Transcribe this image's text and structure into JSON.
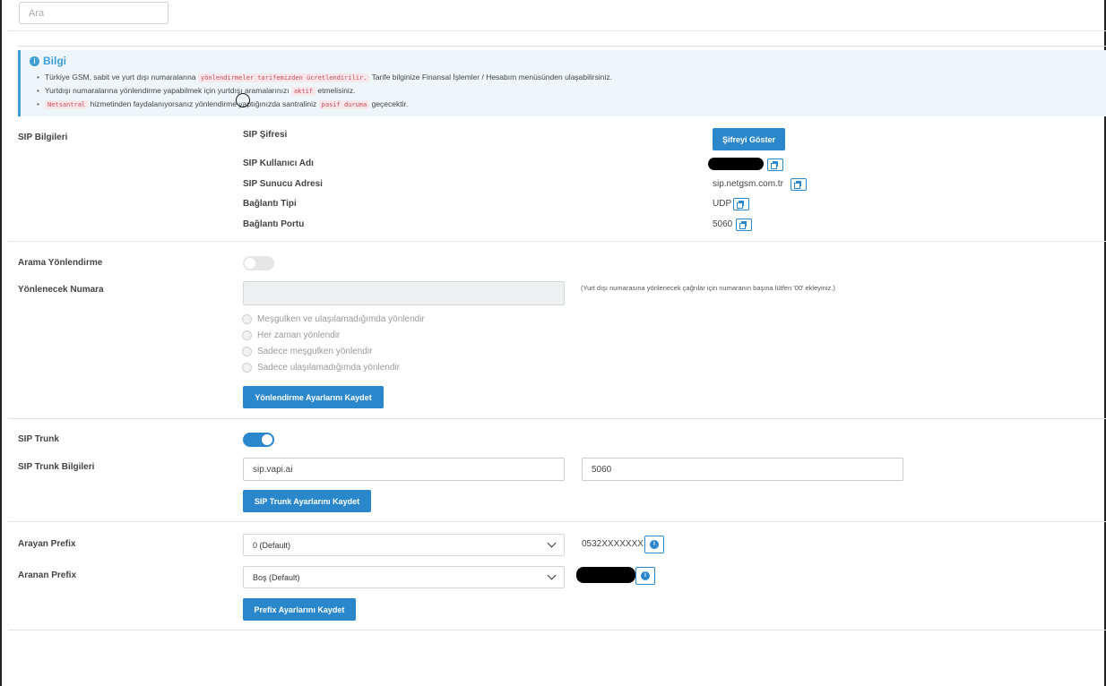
{
  "search": {
    "placeholder": "Ara"
  },
  "info": {
    "title": "Bilgi",
    "items": [
      {
        "pre": "Türkiye GSM, sabit ve yurt dışı numaralarına ",
        "code": "yönlendirmeler tarifemizden ücretlendirilir.",
        "post": " Tarife bilginize Finansal İşlemler / Hesabım menüsünden ulaşabilirsiniz."
      },
      {
        "pre": "Yurtdışı numaralarına yönlendirme yapabilmek için yurtdışı aramalarınızı ",
        "code": "aktif",
        "post": " etmelisiniz."
      },
      {
        "pre": "",
        "code": "Netsantral",
        "post": " hizmetinden faydalanıyorsanız yönlendirme yaptığınızda santraliniz ",
        "code2": "pasif duruma",
        "post2": " geçecektir."
      }
    ]
  },
  "sip": {
    "section_label": "SIP Bilgileri",
    "password_label": "SIP Şifresi",
    "show_password_button": "Şifreyi Göster",
    "username_label": "SIP Kullanıcı Adı",
    "server_label": "SIP Sunucu Adresi",
    "server_value": "sip.netgsm.com.tr",
    "conn_type_label": "Bağlantı Tipi",
    "conn_type_value": "UDP",
    "port_label": "Bağlantı Portu",
    "port_value": "5060"
  },
  "forward": {
    "section_label": "Arama Yönlendirme",
    "enabled": false,
    "number_label": "Yönlenecek Numara",
    "number_value": "",
    "hint": "(Yurt dışı numarasına yönlenecek çağrılar için numaranın başına lütfen '00' ekleyiniz.)",
    "options": [
      "Meşgulken ve ulaşılamadığımda yönlendir",
      "Her zaman yönlendir",
      "Sadece meşgulken yönlendir",
      "Sadece ulaşılamadığımda yönlendir"
    ],
    "save_button": "Yönlendirme Ayarlarını Kaydet"
  },
  "trunk": {
    "section_label": "SIP Trunk",
    "enabled": true,
    "info_label": "SIP Trunk Bilgileri",
    "host_value": "sip.vapi.ai",
    "port_value": "5060",
    "save_button": "SIP Trunk Ayarlarını Kaydet"
  },
  "prefix": {
    "caller_label": "Arayan Prefix",
    "caller_selected": "0 (Default)",
    "caller_example": "0532XXXXXXX",
    "callee_label": "Aranan Prefix",
    "callee_selected": "Boş (Default)",
    "save_button": "Prefix Ayarlarını Kaydet"
  },
  "colors": {
    "accent": "#2a87cc",
    "info_bg": "#eef6fb",
    "info_border": "#3c9ed4"
  }
}
